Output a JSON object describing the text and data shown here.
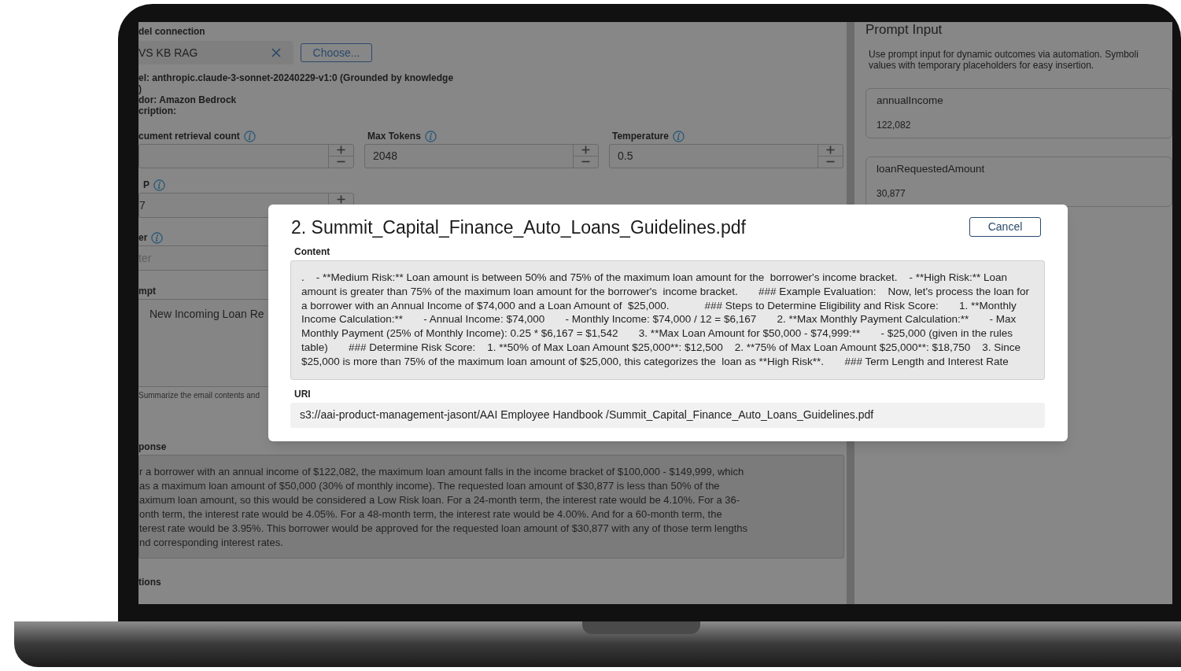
{
  "left_panel": {
    "model_connection": {
      "label": "del connection",
      "value": "VS KB RAG",
      "choose_button": "Choose..."
    },
    "model_details": [
      "el: anthropic.claude-3-sonnet-20240229-v1:0 (Grounded by knowledge",
      ")",
      "dor: Amazon Bedrock",
      "cription:"
    ],
    "number_fields": [
      {
        "label": "cument retrieval count"
      },
      {
        "label": "Max Tokens",
        "value": "2048"
      },
      {
        "label": "Temperature",
        "value": "0.5"
      }
    ],
    "top_p": {
      "label": "P",
      "value": "7"
    },
    "filter": {
      "label": "er",
      "placeholder": "ter"
    },
    "prompt": {
      "label": "mpt",
      "value": "New Incoming Loan Re",
      "hint": "Summarize the email contents and"
    },
    "response": {
      "label": "ponse",
      "lines": [
        "r a borrower with an annual income of $122,082, the maximum loan amount falls in the income bracket of $100,000 - $149,999, which",
        "as a maximum loan amount of $50,000 (30% of monthly income). The requested loan amount of $30,877 is less than 50% of the",
        "aximum loan amount, so this would be considered a Low Risk loan. For a 24-month term, the interest rate would be 4.10%. For a 36-",
        "onth term, the interest rate would be 4.05%. For a 48-month term, the interest rate would be 4.00%. And for a 60-month term, the",
        "terest rate would be 3.95%. This borrower would be approved for the requested loan amount of $30,877 with any of those term lengths",
        "nd corresponding interest rates."
      ]
    },
    "section_label": "tions"
  },
  "prompt_input": {
    "title": "Prompt Input",
    "description": [
      "Use prompt input for dynamic outcomes via automation. Symboli",
      "values with temporary placeholders for easy insertion."
    ],
    "variables": [
      {
        "name": "annualIncome",
        "value": "122,082"
      },
      {
        "name": "loanRequestedAmount",
        "value": "30,877"
      }
    ]
  },
  "modal": {
    "title": "2. Summit_Capital_Finance_Auto_Loans_Guidelines.pdf",
    "cancel_button": "Cancel",
    "content_label": "Content",
    "content": ".    - **Medium Risk:** Loan amount is between 50% and 75% of the maximum loan amount for the  borrower's income bracket.    - **High Risk:** Loan amount is greater than 75% of the maximum loan amount for the borrower's  income bracket.       ### Example Evaluation:    Now, let's process the loan for a borrower with an Annual Income of $74,000 and a Loan Amount of  $25,000.            ### Steps to Determine Eligibility and Risk Score:       1. **Monthly Income Calculation:**       - Annual Income: $74,000       - Monthly Income: $74,000 / 12 = $6,167       2. **Max Monthly Payment Calculation:**       - Max Monthly Payment (25% of Monthly Income): 0.25 * $6,167 = $1,542       3. **Max Loan Amount for $50,000 - $74,999:**       - $25,000 (given in the rules table)       ### Determine Risk Score:    1. **50% of Max Loan Amount $25,000**: $12,500    2. **75% of Max Loan Amount $25,000**: $18,750    3. Since $25,000 is more than 75% of the maximum loan amount of $25,000, this categorizes the  loan as **High Risk**.       ### Term Length and Interest Rate",
    "uri_label": "URI",
    "uri": "s3://aai-product-management-jasont/AAI Employee Handbook /Summit_Capital_Finance_Auto_Loans_Guidelines.pdf"
  }
}
